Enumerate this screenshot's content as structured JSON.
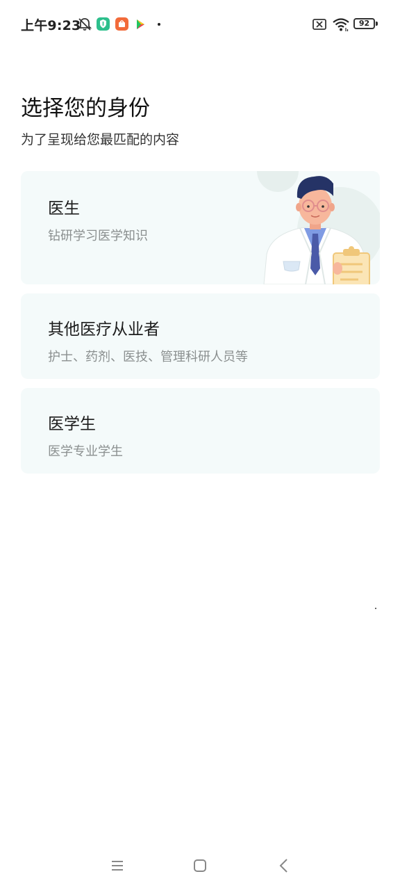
{
  "status_bar": {
    "time": "上午9:23",
    "battery": "92",
    "icons": [
      "bell-off-icon",
      "shield-app-icon",
      "shopping-app-icon",
      "play-app-icon",
      "sim-off-icon",
      "wifi-icon",
      "battery-icon"
    ],
    "colors": {
      "shield_app": "#2dbf8c",
      "shopping_app": "#f26b3a"
    }
  },
  "header": {
    "title": "选择您的身份",
    "subtitle": "为了呈现给您最匹配的内容"
  },
  "options": [
    {
      "title": "医生",
      "description": "钻研学习医学知识"
    },
    {
      "title": "其他医疗从业者",
      "description": "护士、药剂、医技、管理科研人员等"
    },
    {
      "title": "医学生",
      "description": "医学专业学生"
    }
  ],
  "theme": {
    "card_background": "#f4fafa",
    "accent": "#e8f1ef"
  },
  "nav_bar": {
    "icons": [
      "menu-icon",
      "home-square-icon",
      "back-chevron-icon"
    ]
  }
}
